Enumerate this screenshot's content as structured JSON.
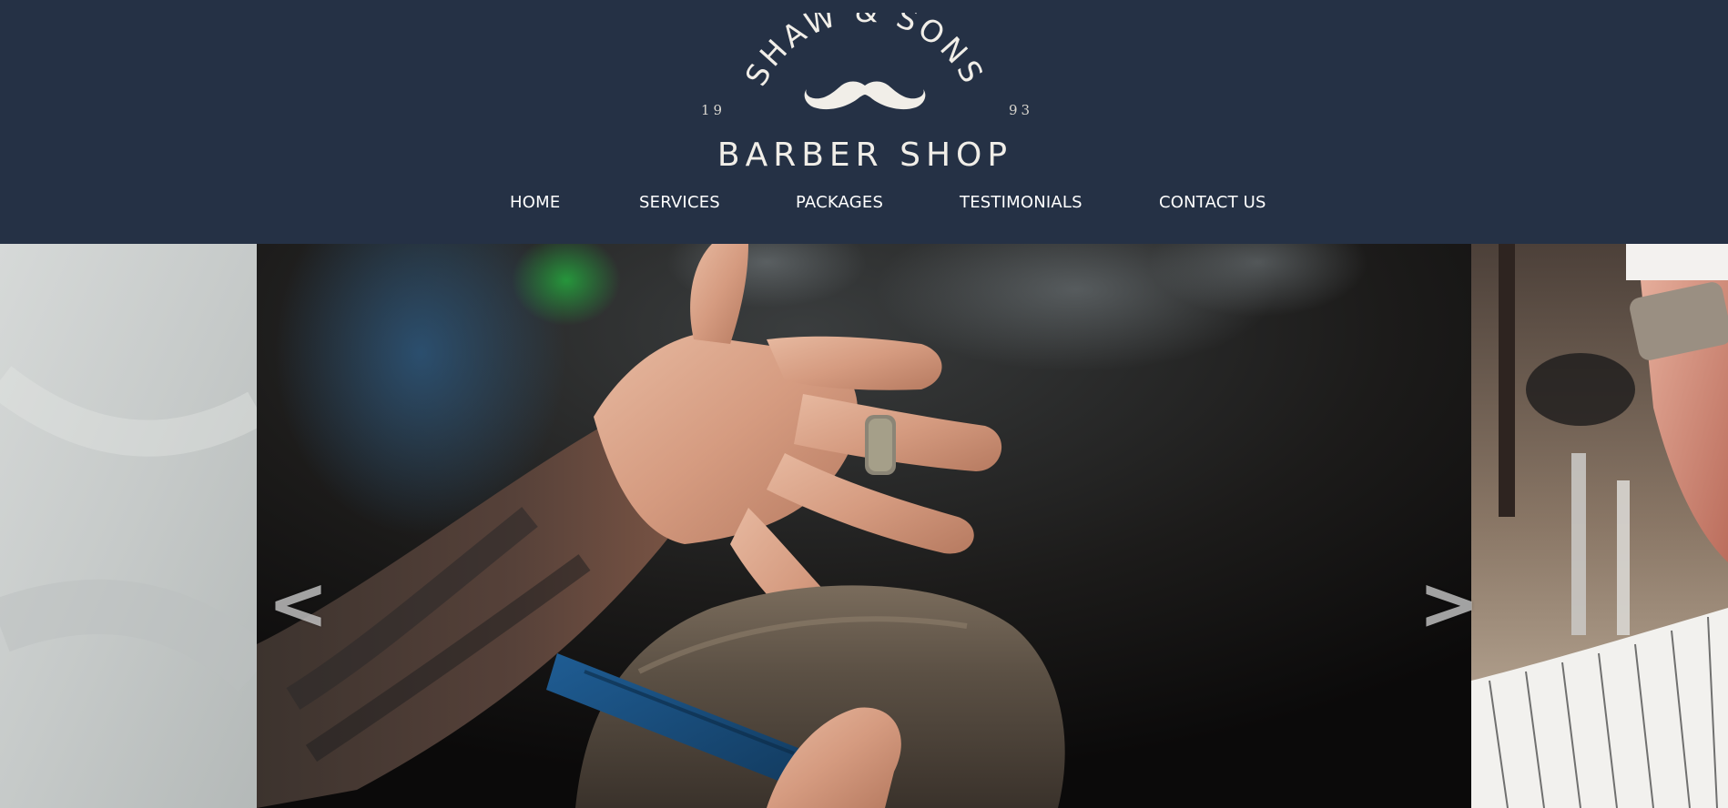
{
  "brand": {
    "name_arc": "SHAW & SONS",
    "year_left": "19",
    "year_right": "93",
    "subtitle": "BARBER SHOP",
    "logo_color": "#f1eee8",
    "header_bg": "#253145"
  },
  "nav": {
    "items": [
      {
        "label": "HOME"
      },
      {
        "label": "SERVICES"
      },
      {
        "label": "PACKAGES"
      },
      {
        "label": "TESTIMONIALS"
      },
      {
        "label": "CONTACT US"
      }
    ]
  },
  "carousel": {
    "prev_arrow": "<",
    "next_arrow": ">",
    "arrow_color": "#cdcdcd",
    "slides": [
      {
        "label": "previous-slide"
      },
      {
        "label": "barber-haircut-slide"
      },
      {
        "label": "next-slide"
      }
    ]
  }
}
